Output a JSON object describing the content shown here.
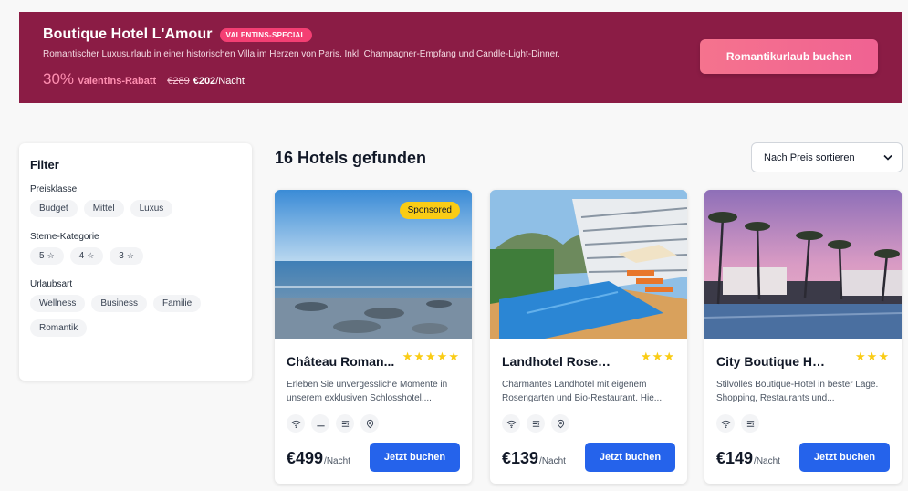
{
  "banner": {
    "title": "Boutique Hotel L'Amour",
    "badge": "VALENTINS-SPECIAL",
    "description": "Romantischer Luxusurlaub in einer historischen Villa im Herzen von Paris. Inkl. Champagner-Empfang und Candle-Light-Dinner.",
    "discount_value": "30%",
    "discount_label": "Valentins-Rabatt",
    "old_price": "€289",
    "new_price": "€202",
    "per_night": "/Nacht",
    "cta": "Romantikurlaub buchen"
  },
  "filter": {
    "title": "Filter",
    "groups": [
      {
        "label": "Preisklasse",
        "options": [
          "Budget",
          "Mittel",
          "Luxus"
        ]
      },
      {
        "label": "Sterne-Kategorie",
        "options": [
          "5",
          "4",
          "3"
        ]
      },
      {
        "label": "Urlaubsart",
        "options": [
          "Wellness",
          "Business",
          "Familie",
          "Romantik"
        ]
      }
    ]
  },
  "results": {
    "count_text": "16 Hotels gefunden",
    "sort_selected": "Nach Preis sortieren"
  },
  "cards": [
    {
      "name": "Château Roman...",
      "stars": "★★★★★",
      "sponsored": "Sponsored",
      "description": "Erleben Sie unvergessliche Momente in unserem exklusiven Schlosshotel....",
      "amenities": [
        "wifi-icon",
        "bed-icon",
        "restaurant-icon",
        "location-icon"
      ],
      "price": "€499",
      "per_night": "/Nacht",
      "cta": "Jetzt buchen"
    },
    {
      "name": "Landhotel Rosengar...",
      "stars": "★★★",
      "description": "Charmantes Landhotel mit eigenem Rosengarten und Bio-Restaurant. Hie...",
      "amenities": [
        "wifi-icon",
        "restaurant-icon",
        "location-icon"
      ],
      "price": "€139",
      "per_night": "/Nacht",
      "cta": "Jetzt buchen"
    },
    {
      "name": "City Boutique Hotel",
      "stars": "★★★",
      "description": "Stilvolles Boutique-Hotel in bester Lage. Shopping, Restaurants und...",
      "amenities": [
        "wifi-icon",
        "restaurant-icon"
      ],
      "price": "€149",
      "per_night": "/Nacht",
      "cta": "Jetzt buchen"
    }
  ],
  "colors": {
    "banner_bg": "#8b1c45",
    "accent_pink": "#f06292",
    "primary_blue": "#2563eb",
    "star_yellow": "#facc15"
  }
}
